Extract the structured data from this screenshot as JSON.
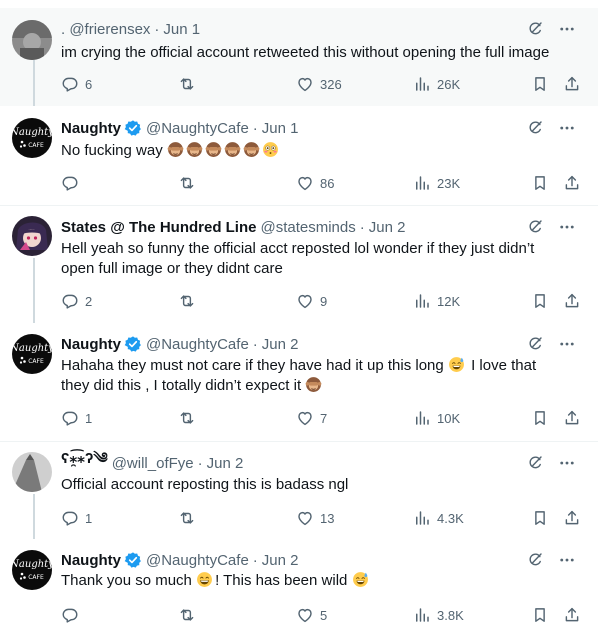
{
  "posts": [
    {
      "display_name": "",
      "handle": ". @frierensex",
      "date": "Jun 1",
      "text": "im crying the official account retweeted this without opening the full image",
      "text_line2": "",
      "replies": "6",
      "reposts": "",
      "likes": "326",
      "views": "26K",
      "avatar": "gray-photo-avatar"
    },
    {
      "display_name": "Naughty",
      "handle": "@NaughtyCafe",
      "date": "Jun 1",
      "text": "No fucking way",
      "text_line2": "",
      "emojis": [
        "see-no-evil-monkey",
        "see-no-evil-monkey",
        "see-no-evil-monkey",
        "see-no-evil-monkey",
        "see-no-evil-monkey",
        "flushed-face"
      ],
      "replies": "",
      "reposts": "",
      "likes": "86",
      "views": "23K",
      "avatar": "naughty-cafe-logo"
    },
    {
      "display_name": "States @ The Hundred Line",
      "handle": "@statesminds",
      "date": "Jun 2",
      "text": "Hell yeah so funny the official acct reposted lol wonder if they just didn’t",
      "text_line2": "open full image or they didnt care",
      "replies": "2",
      "reposts": "",
      "likes": "9",
      "views": "12K",
      "avatar": "anime-character-avatar"
    },
    {
      "display_name": "Naughty",
      "handle": "@NaughtyCafe",
      "date": "Jun 2",
      "text": "Hahaha they must not care if they have had it up this long",
      "text_after_emoji": "I love that",
      "text_line2": "they did this , I totally didn’t expect it",
      "replies": "1",
      "reposts": "",
      "likes": "7",
      "views": "10K",
      "avatar": "naughty-cafe-logo"
    },
    {
      "display_name": "ʕ⁎̯͡⁎ʔ༄",
      "handle": "@will_ofFye",
      "date": "Jun 2",
      "text": "Official account reposting this is badass ngl",
      "text_line2": "",
      "replies": "1",
      "reposts": "",
      "likes": "13",
      "views": "4.3K",
      "avatar": "gray-photo-avatar"
    },
    {
      "display_name": "Naughty",
      "handle": "@NaughtyCafe",
      "date": "Jun 2",
      "text": "Thank you so much",
      "text_after_emoji": "! This has been wild",
      "text_line2": "",
      "replies": "",
      "reposts": "",
      "likes": "5",
      "views": "3.8K",
      "avatar": "naughty-cafe-logo"
    }
  ],
  "logo_text": "Naughty CAFE",
  "colors": {
    "text": "#0f1419",
    "secondary": "#536471",
    "verified": "#1d9bf0",
    "thread_line": "#cfd9de",
    "highlight_bg": "#f7f9f9",
    "divider": "#eff3f4"
  },
  "icons": {
    "top": [
      "grok-icon",
      "more-icon"
    ],
    "actions": [
      "reply-icon",
      "repost-icon",
      "like-icon",
      "views-icon",
      "bookmark-icon",
      "share-icon"
    ]
  }
}
